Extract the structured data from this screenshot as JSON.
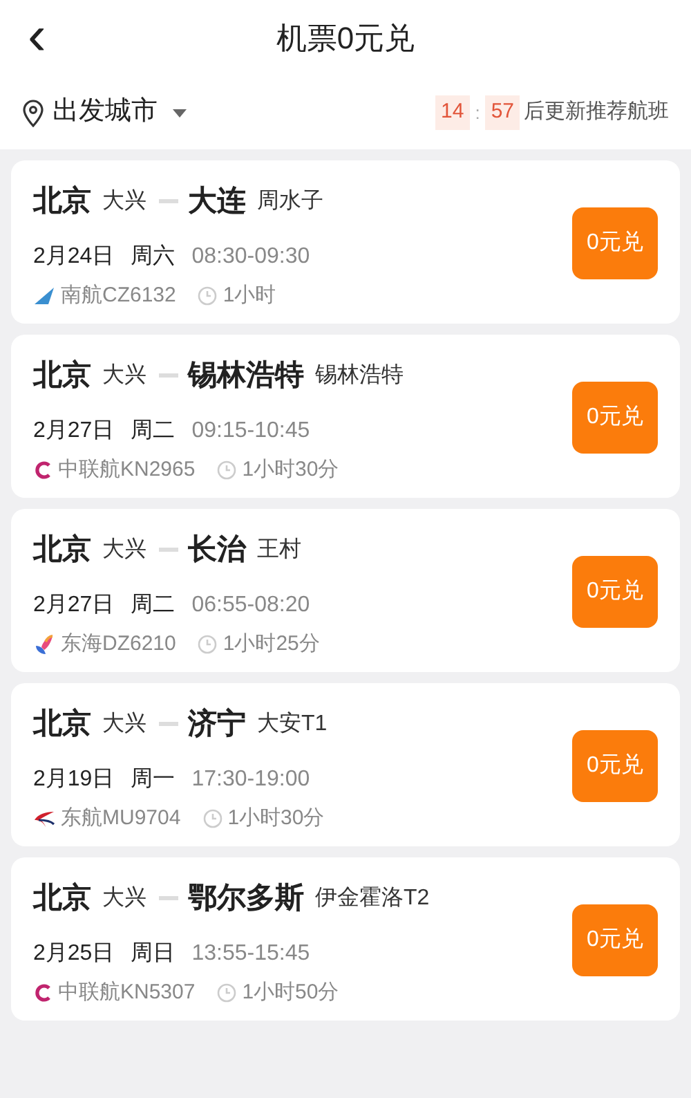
{
  "header": {
    "back": "‹",
    "title": "机票0元兑"
  },
  "filter": {
    "label": "出发城市",
    "countdown_minutes": "14",
    "countdown_sep": ":",
    "countdown_seconds": "57",
    "countdown_text": "后更新推荐航班"
  },
  "flights": [
    {
      "from": "北京",
      "from_airport": "大兴",
      "to": "大连",
      "to_airport": "周水子",
      "date": "2月24日",
      "weekday": "周六",
      "time": "08:30-09:30",
      "airline": "南航CZ6132",
      "kind": "tail",
      "duration": "1小时",
      "button": "0元兑"
    },
    {
      "from": "北京",
      "from_airport": "大兴",
      "to": "锡林浩特",
      "to_airport": "锡林浩特",
      "date": "2月27日",
      "weekday": "周二",
      "time": "09:15-10:45",
      "airline": "中联航KN2965",
      "kind": "ring",
      "duration": "1小时30分",
      "button": "0元兑"
    },
    {
      "from": "北京",
      "from_airport": "大兴",
      "to": "长治",
      "to_airport": "王村",
      "date": "2月27日",
      "weekday": "周二",
      "time": "06:55-08:20",
      "airline": "东海DZ6210",
      "kind": "bird",
      "duration": "1小时25分",
      "button": "0元兑"
    },
    {
      "from": "北京",
      "from_airport": "大兴",
      "to": "济宁",
      "to_airport": "大安T1",
      "date": "2月19日",
      "weekday": "周一",
      "time": "17:30-19:00",
      "airline": "东航MU9704",
      "kind": "swallow",
      "duration": "1小时30分",
      "button": "0元兑"
    },
    {
      "from": "北京",
      "from_airport": "大兴",
      "to": "鄂尔多斯",
      "to_airport": "伊金霍洛T2",
      "date": "2月25日",
      "weekday": "周日",
      "time": "13:55-15:45",
      "airline": "中联航KN5307",
      "kind": "ring",
      "duration": "1小时50分",
      "button": "0元兑"
    }
  ]
}
